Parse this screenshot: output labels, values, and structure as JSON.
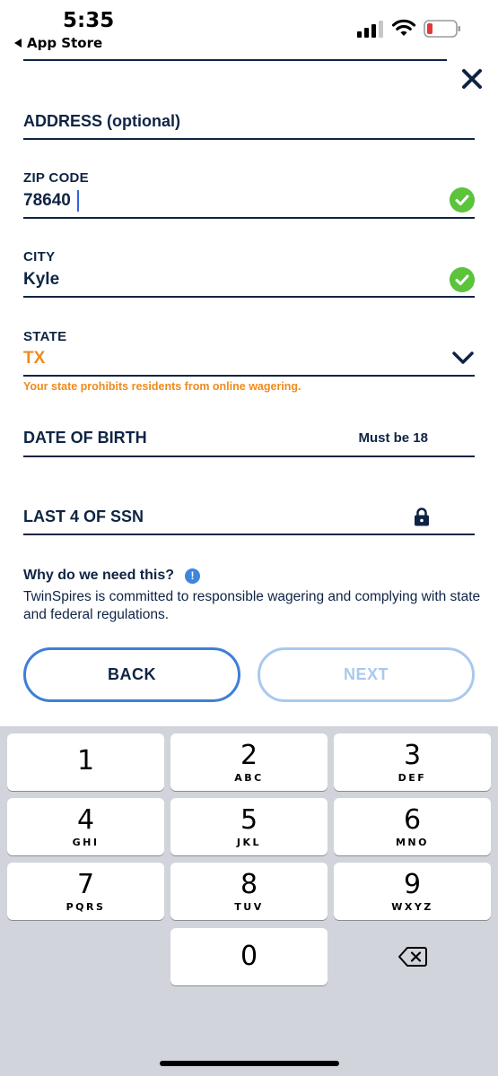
{
  "status_bar": {
    "time": "5:35",
    "back_app": "App Store"
  },
  "form": {
    "address_placeholder": "ADDRESS (optional)",
    "zip": {
      "label": "ZIP CODE",
      "value": "78640",
      "valid": true
    },
    "city": {
      "label": "CITY",
      "value": "Kyle",
      "valid": true
    },
    "state": {
      "label": "STATE",
      "value": "TX",
      "error": "Your state prohibits residents from online wagering."
    },
    "dob": {
      "placeholder": "DATE OF BIRTH",
      "hint": "Must be 18"
    },
    "ssn": {
      "placeholder": "LAST 4 OF SSN"
    }
  },
  "info": {
    "title": "Why do we need this?",
    "icon_glyph": "!",
    "text": "TwinSpires is committed to responsible wagering and complying with state and federal regulations."
  },
  "buttons": {
    "back": "BACK",
    "next": "NEXT"
  },
  "keypad": {
    "keys": [
      {
        "digit": "1",
        "letters": ""
      },
      {
        "digit": "2",
        "letters": "ABC"
      },
      {
        "digit": "3",
        "letters": "DEF"
      },
      {
        "digit": "4",
        "letters": "GHI"
      },
      {
        "digit": "5",
        "letters": "JKL"
      },
      {
        "digit": "6",
        "letters": "MNO"
      },
      {
        "digit": "7",
        "letters": "PQRS"
      },
      {
        "digit": "8",
        "letters": "TUV"
      },
      {
        "digit": "9",
        "letters": "WXYZ"
      },
      {
        "digit": "0",
        "letters": ""
      }
    ]
  },
  "colors": {
    "navy": "#0f2444",
    "accent_blue": "#3d7fd6",
    "warning_orange": "#f08a1c",
    "success_green": "#5cc33c"
  },
  "icons": {
    "close": "close-icon",
    "check": "check-circle-icon",
    "chevron": "chevron-down-icon",
    "lock": "lock-icon",
    "info": "info-icon",
    "delete": "backspace-icon"
  }
}
